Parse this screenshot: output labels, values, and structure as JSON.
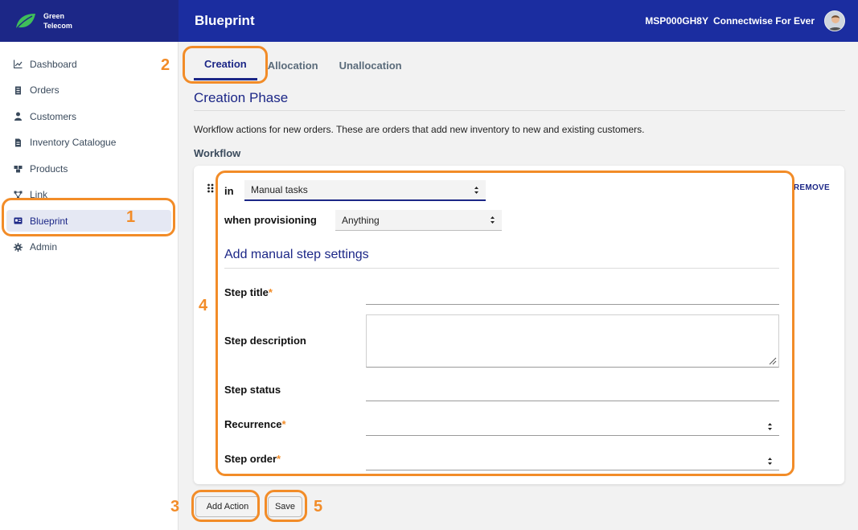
{
  "brand": {
    "line1": "Green",
    "line2": "Telecom",
    "logo_color": "#3fbf5a"
  },
  "header": {
    "title": "Blueprint",
    "account_id": "MSP000GH8Y",
    "tenant": "Connectwise For Ever",
    "bar_color": "#1b2da0"
  },
  "sidebar": {
    "items": [
      {
        "label": "Dashboard",
        "icon": "chart-line-icon"
      },
      {
        "label": "Orders",
        "icon": "document-icon"
      },
      {
        "label": "Customers",
        "icon": "user-icon"
      },
      {
        "label": "Inventory Catalogue",
        "icon": "file-icon"
      },
      {
        "label": "Products",
        "icon": "boxes-icon"
      },
      {
        "label": "Link",
        "icon": "link-icon"
      },
      {
        "label": "Blueprint",
        "icon": "id-card-icon",
        "active": true
      },
      {
        "label": "Admin",
        "icon": "gear-icon"
      }
    ]
  },
  "tabs": [
    {
      "label": "Creation",
      "active": true
    },
    {
      "label": "Allocation"
    },
    {
      "label": "Unallocation"
    }
  ],
  "section": {
    "title": "Creation Phase",
    "description": "Workflow actions for new orders. These are orders that add new inventory to new and existing customers.",
    "workflow_label": "Workflow"
  },
  "card": {
    "remove_label": "REMOVE",
    "in_label": "in",
    "in_value": "Manual tasks",
    "provisioning_label": "when provisioning",
    "provisioning_value": "Anything",
    "settings_title": "Add manual step settings",
    "fields": {
      "step_title": "Step title",
      "step_description": "Step description",
      "step_status": "Step status",
      "recurrence": "Recurrence",
      "step_order": "Step order",
      "required_mark": "*"
    }
  },
  "buttons": {
    "add_action": "Add Action",
    "save": "Save"
  },
  "annotations": {
    "n1": "1",
    "n2": "2",
    "n3": "3",
    "n4": "4",
    "n5": "5",
    "color": "#f28c28"
  }
}
